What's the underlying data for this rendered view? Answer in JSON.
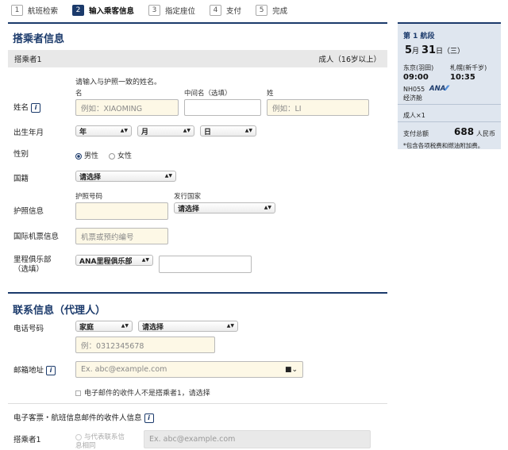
{
  "steps": [
    {
      "num": "1",
      "label": "航班检索"
    },
    {
      "num": "2",
      "label": "输入乘客信息"
    },
    {
      "num": "3",
      "label": "指定座位"
    },
    {
      "num": "4",
      "label": "支付"
    },
    {
      "num": "5",
      "label": "完成"
    }
  ],
  "passenger": {
    "section_title": "搭乘者信息",
    "pax_label": "搭乘者1",
    "pax_type": "成人（16岁以上）",
    "name_hint": "请输入与护照一致的姓名。",
    "name_label": "姓名",
    "first_label": "名",
    "middle_label": "中间名（选填）",
    "last_label": "姓",
    "first_placeholder": "例如：XIAOMING",
    "last_placeholder": "例如：LI",
    "dob_label": "出生年月",
    "year": "年",
    "month": "月",
    "day": "日",
    "gender_label": "性别",
    "male": "男性",
    "female": "女性",
    "nationality_label": "国籍",
    "nationality_value": "请选择",
    "passport_label": "护照信息",
    "passport_no_label": "护照号码",
    "issuer_label": "发行国家",
    "issuer_value": "请选择",
    "intl_ticket_label": "国际机票信息",
    "intl_ticket_placeholder": "机票或预约编号",
    "mileage_label": "里程俱乐部\n（选填）",
    "mileage_value": "ANA里程俱乐部"
  },
  "contact": {
    "section_title": "联系信息（代理人）",
    "phone_label": "电话号码",
    "phone_type": "家庭",
    "phone_country": "请选择",
    "phone_placeholder": "例：0312345678",
    "email_label": "邮箱地址",
    "email_placeholder": "Ex. abc@example.com",
    "not_passenger": "电子邮件的收件人不是搭乘者1，请选择",
    "eticket_label": "电子客票・航班信息邮件的收件人信息",
    "pax1_label": "搭乘者1",
    "same_as_contact": "与代表联系信息相同",
    "eticket_email_placeholder": "Ex. abc@example.com"
  },
  "summary": {
    "segment": "第 1 航段",
    "month": "5",
    "month_suffix": "月",
    "day": "31",
    "day_suffix": "日",
    "weekday": "（三）",
    "from_airport": "东京(羽田)",
    "to_airport": "札幌(新千岁)",
    "dep_time": "09:00",
    "arr_time": "10:35",
    "flight": "NH055",
    "airline_logo": "ANA",
    "cabin": "经济舱",
    "pax_count": "成人×1",
    "total_label": "支付总额",
    "total_amount": "688",
    "currency": "人民币",
    "tax_note": "*包含各项税费和燃油附加费。"
  },
  "colors": {
    "accent": "#1b3a6b"
  }
}
